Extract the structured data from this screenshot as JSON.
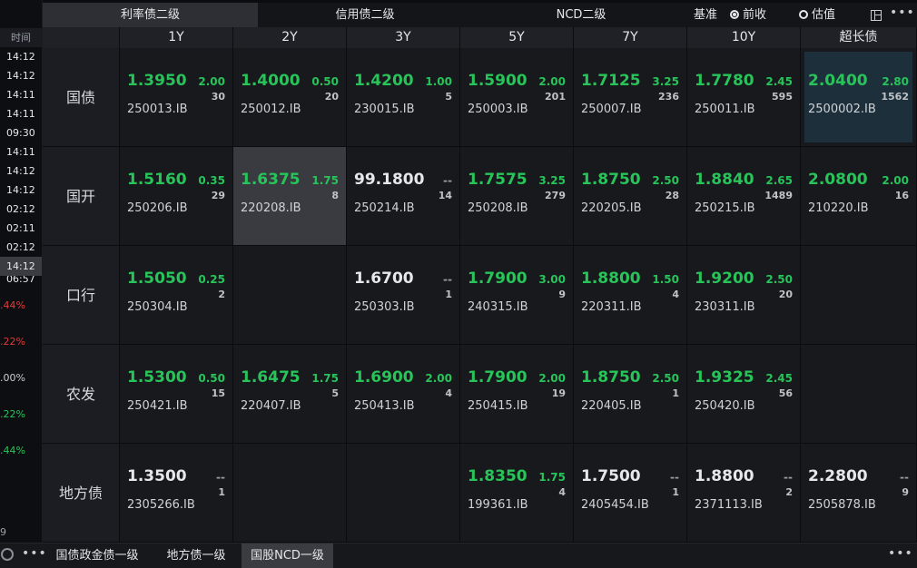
{
  "tabs": {
    "items": [
      "利率债二级",
      "信用债二级",
      "NCD二级"
    ],
    "active": 0,
    "basis_label": "基准",
    "opt_prev": "前收",
    "opt_est": "估值",
    "selected": "前收"
  },
  "left": {
    "time_header": "时间",
    "times": [
      "14:12",
      "14:12",
      "14:11",
      "14:11",
      "09:30",
      "14:11",
      "14:12",
      "14:12",
      "02:12",
      "02:11",
      "02:12",
      "14:12",
      "06:57"
    ],
    "selected_index": 11,
    "pcts": [
      {
        "text": ".44%",
        "color": "#e03a3a"
      },
      {
        "text": ".22%",
        "color": "#e03a3a"
      },
      {
        "text": ".00%",
        "color": "#c9ccd1"
      },
      {
        "text": ".22%",
        "color": "#28c45a"
      },
      {
        "text": ".44%",
        "color": "#28c45a"
      }
    ],
    "foot_num": "9"
  },
  "grid": {
    "columns": [
      "1Y",
      "2Y",
      "3Y",
      "5Y",
      "7Y",
      "10Y",
      "超长债"
    ],
    "rows": [
      {
        "name": "国债",
        "cells": [
          {
            "yield": "1.3950",
            "vol": "2.00",
            "cnt": "30",
            "code": "250013.IB",
            "color": "green"
          },
          {
            "yield": "1.4000",
            "vol": "0.50",
            "cnt": "20",
            "code": "250012.IB",
            "color": "green"
          },
          {
            "yield": "1.4200",
            "vol": "1.00",
            "cnt": "5",
            "code": "230015.IB",
            "color": "green"
          },
          {
            "yield": "1.5900",
            "vol": "2.00",
            "cnt": "201",
            "code": "250003.IB",
            "color": "green"
          },
          {
            "yield": "1.7125",
            "vol": "3.25",
            "cnt": "236",
            "code": "250007.IB",
            "color": "green"
          },
          {
            "yield": "1.7780",
            "vol": "2.45",
            "cnt": "595",
            "code": "250011.IB",
            "color": "green"
          },
          {
            "yield": "2.0400",
            "vol": "2.80",
            "cnt": "1562",
            "code": "2500002.IB",
            "color": "green",
            "hl": "blue"
          }
        ]
      },
      {
        "name": "国开",
        "cells": [
          {
            "yield": "1.5160",
            "vol": "0.35",
            "cnt": "29",
            "code": "250206.IB",
            "color": "green"
          },
          {
            "yield": "1.6375",
            "vol": "1.75",
            "cnt": "8",
            "code": "220208.IB",
            "color": "green",
            "hl": "gray"
          },
          {
            "yield": "99.1800",
            "vol": "--",
            "cnt": "14",
            "code": "250214.IB",
            "color": "white"
          },
          {
            "yield": "1.7575",
            "vol": "3.25",
            "cnt": "279",
            "code": "250208.IB",
            "color": "green"
          },
          {
            "yield": "1.8750",
            "vol": "2.50",
            "cnt": "28",
            "code": "220205.IB",
            "color": "green"
          },
          {
            "yield": "1.8840",
            "vol": "2.65",
            "cnt": "1489",
            "code": "250215.IB",
            "color": "green"
          },
          {
            "yield": "2.0800",
            "vol": "2.00",
            "cnt": "16",
            "code": "210220.IB",
            "color": "green"
          }
        ]
      },
      {
        "name": "口行",
        "cells": [
          {
            "yield": "1.5050",
            "vol": "0.25",
            "cnt": "2",
            "code": "250304.IB",
            "color": "green"
          },
          null,
          {
            "yield": "1.6700",
            "vol": "--",
            "cnt": "1",
            "code": "250303.IB",
            "color": "white"
          },
          {
            "yield": "1.7900",
            "vol": "3.00",
            "cnt": "9",
            "code": "240315.IB",
            "color": "green"
          },
          {
            "yield": "1.8800",
            "vol": "1.50",
            "cnt": "4",
            "code": "220311.IB",
            "color": "green"
          },
          {
            "yield": "1.9200",
            "vol": "2.50",
            "cnt": "20",
            "code": "230311.IB",
            "color": "green"
          },
          null
        ]
      },
      {
        "name": "农发",
        "cells": [
          {
            "yield": "1.5300",
            "vol": "0.50",
            "cnt": "15",
            "code": "250421.IB",
            "color": "green"
          },
          {
            "yield": "1.6475",
            "vol": "1.75",
            "cnt": "5",
            "code": "220407.IB",
            "color": "green"
          },
          {
            "yield": "1.6900",
            "vol": "2.00",
            "cnt": "4",
            "code": "250413.IB",
            "color": "green"
          },
          {
            "yield": "1.7900",
            "vol": "2.00",
            "cnt": "19",
            "code": "250415.IB",
            "color": "green"
          },
          {
            "yield": "1.8750",
            "vol": "2.50",
            "cnt": "1",
            "code": "220405.IB",
            "color": "green"
          },
          {
            "yield": "1.9325",
            "vol": "2.45",
            "cnt": "56",
            "code": "250420.IB",
            "color": "green"
          },
          null
        ]
      },
      {
        "name": "地方债",
        "cells": [
          {
            "yield": "1.3500",
            "vol": "--",
            "cnt": "1",
            "code": "2305266.IB",
            "color": "white"
          },
          null,
          null,
          {
            "yield": "1.8350",
            "vol": "1.75",
            "cnt": "4",
            "code": "199361.IB",
            "color": "green"
          },
          {
            "yield": "1.7500",
            "vol": "--",
            "cnt": "1",
            "code": "2405454.IB",
            "color": "white"
          },
          {
            "yield": "1.8800",
            "vol": "--",
            "cnt": "2",
            "code": "2371113.IB",
            "color": "white"
          },
          {
            "yield": "2.2800",
            "vol": "--",
            "cnt": "9",
            "code": "2505878.IB",
            "color": "white"
          }
        ]
      }
    ]
  },
  "bottom": {
    "tabs": [
      "国债政金债一级",
      "地方债一级",
      "国股NCD一级"
    ],
    "active": 2,
    "more": "•••"
  }
}
